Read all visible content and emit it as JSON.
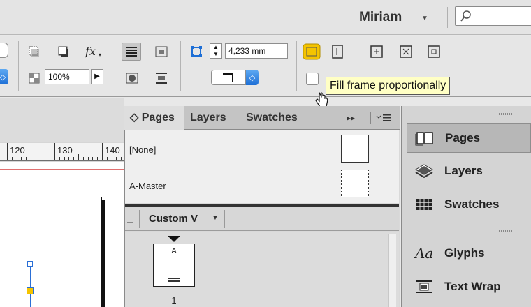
{
  "header": {
    "user_name": "Miriam"
  },
  "control_bar": {
    "scale_value": "100%",
    "weight_value": "4,233 mm"
  },
  "tooltip": {
    "text": "Fill frame proportionally"
  },
  "ruler": {
    "labels": [
      "120",
      "130",
      "140"
    ]
  },
  "pages_panel": {
    "tabs": [
      {
        "label": "◇ Pages",
        "active": true
      },
      {
        "label": "Layers",
        "active": false
      },
      {
        "label": "Swatches",
        "active": false
      }
    ],
    "tab_menu_glyphs": "▸▸",
    "masters": [
      "[None]",
      "A-Master"
    ],
    "view_dropdown": "Custom V",
    "page_prefix": "A",
    "page_number": "1"
  },
  "dock": {
    "items": [
      {
        "label": "Pages",
        "icon": "pages-icon",
        "active": true
      },
      {
        "label": "Layers",
        "icon": "layers-icon",
        "active": false
      },
      {
        "label": "Swatches",
        "icon": "swatches-icon",
        "active": false
      },
      {
        "label": "Glyphs",
        "icon": "glyphs-icon",
        "active": false
      },
      {
        "label": "Text Wrap",
        "icon": "text-wrap-icon",
        "active": false
      }
    ],
    "glyphs_icon_text": "Aa"
  },
  "colors": {
    "accent_blue": "#1e6fd6",
    "tooltip_bg": "#ffffc4",
    "selection_handle_fill": "#f5c400"
  }
}
